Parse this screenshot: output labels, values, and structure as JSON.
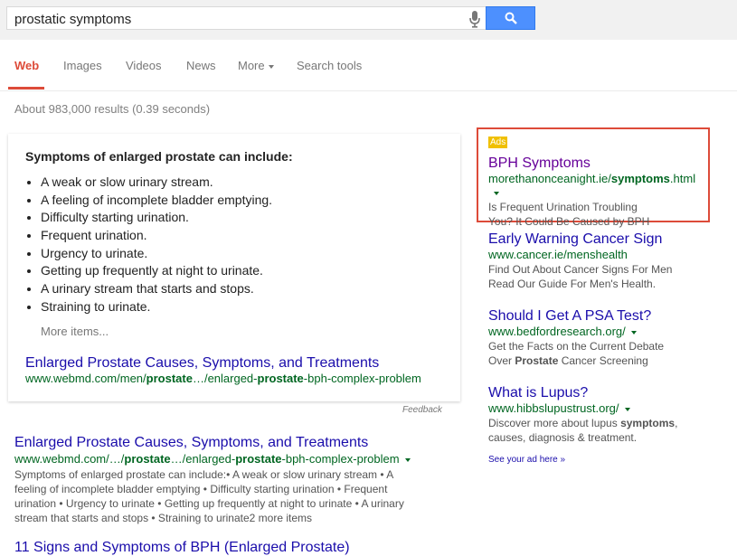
{
  "search": {
    "query": "prostatic symptoms"
  },
  "tabs": [
    {
      "label": "Web"
    },
    {
      "label": "Images"
    },
    {
      "label": "Videos"
    },
    {
      "label": "News"
    },
    {
      "label": "More"
    },
    {
      "label": "Search tools"
    }
  ],
  "result_stats": "About 983,000 results (0.39 seconds)",
  "featured_snippet": {
    "heading": "Symptoms of enlarged prostate can include:",
    "items": [
      "A weak or slow urinary stream.",
      "A feeling of incomplete bladder emptying.",
      "Difficulty starting urination.",
      "Frequent urination.",
      "Urgency to urinate.",
      "Getting up frequently at night to urinate.",
      "A urinary stream that starts and stops.",
      "Straining to urinate."
    ],
    "more_items": "More items...",
    "link_title": "Enlarged Prostate Causes, Symptoms, and Treatments",
    "url_parts": [
      "www.webmd.com/men/",
      "prostate",
      "…/enlarged-",
      "prostate",
      "-bph-complex-problem"
    ],
    "feedback": "Feedback"
  },
  "organic_result": {
    "title": "Enlarged Prostate Causes, Symptoms, and Treatments",
    "url_parts": [
      "www.webmd.com/…/",
      "prostate",
      "…/enlarged-",
      "prostate",
      "-bph-complex-problem"
    ],
    "snippet_lines": [
      "Symptoms of enlarged prostate can include:• A weak or slow urinary stream • A",
      "feeling of incomplete bladder emptying • Difficulty starting urination • Frequent",
      "urination • Urgency to urinate • Getting up frequently at night to urinate • A urinary",
      "stream that starts and stops • Straining to urinate2 more items"
    ]
  },
  "next_result_title": "11 Signs and Symptoms of BPH (Enlarged Prostate)",
  "ads_label": "Ads",
  "ads": [
    {
      "title": "BPH Symptoms",
      "url_parts": [
        "morethanonceanight.ie/",
        "symptoms",
        ".html"
      ],
      "desc_lines": [
        [
          "Is Frequent Urination Troubling"
        ],
        [
          "You? It Could Be Caused by BPH"
        ]
      ]
    },
    {
      "title": "Early Warning Cancer Sign",
      "url_parts": [
        "www.cancer.ie/menshealth"
      ],
      "desc_lines": [
        [
          "Find Out About Cancer Signs For Men"
        ],
        [
          "Read Our Guide For Men's Health."
        ]
      ]
    },
    {
      "title": "Should I Get A PSA Test?",
      "url_parts": [
        "www.bedfordresearch.org/"
      ],
      "desc_lines": [
        [
          "Get the Facts on the Current Debate"
        ],
        [
          "Over ",
          "Prostate",
          " Cancer Screening"
        ]
      ]
    },
    {
      "title": "What is Lupus?",
      "url_parts": [
        "www.hibbslupustrust.org/"
      ],
      "desc_lines": [
        [
          "Discover more about lupus ",
          "symptoms",
          ","
        ],
        [
          "causes, diagnosis & treatment."
        ]
      ]
    }
  ],
  "see_your_ad": "See your ad here »",
  "colors": {
    "link": "#1a0dab",
    "visited_link": "#660099",
    "url_green": "#006621",
    "accent_red": "#dd4b39",
    "search_blue": "#4d90fe",
    "ads_badge": "#f0c000"
  },
  "icons": {
    "mic": "microphone-icon",
    "search": "magnifier-icon"
  }
}
